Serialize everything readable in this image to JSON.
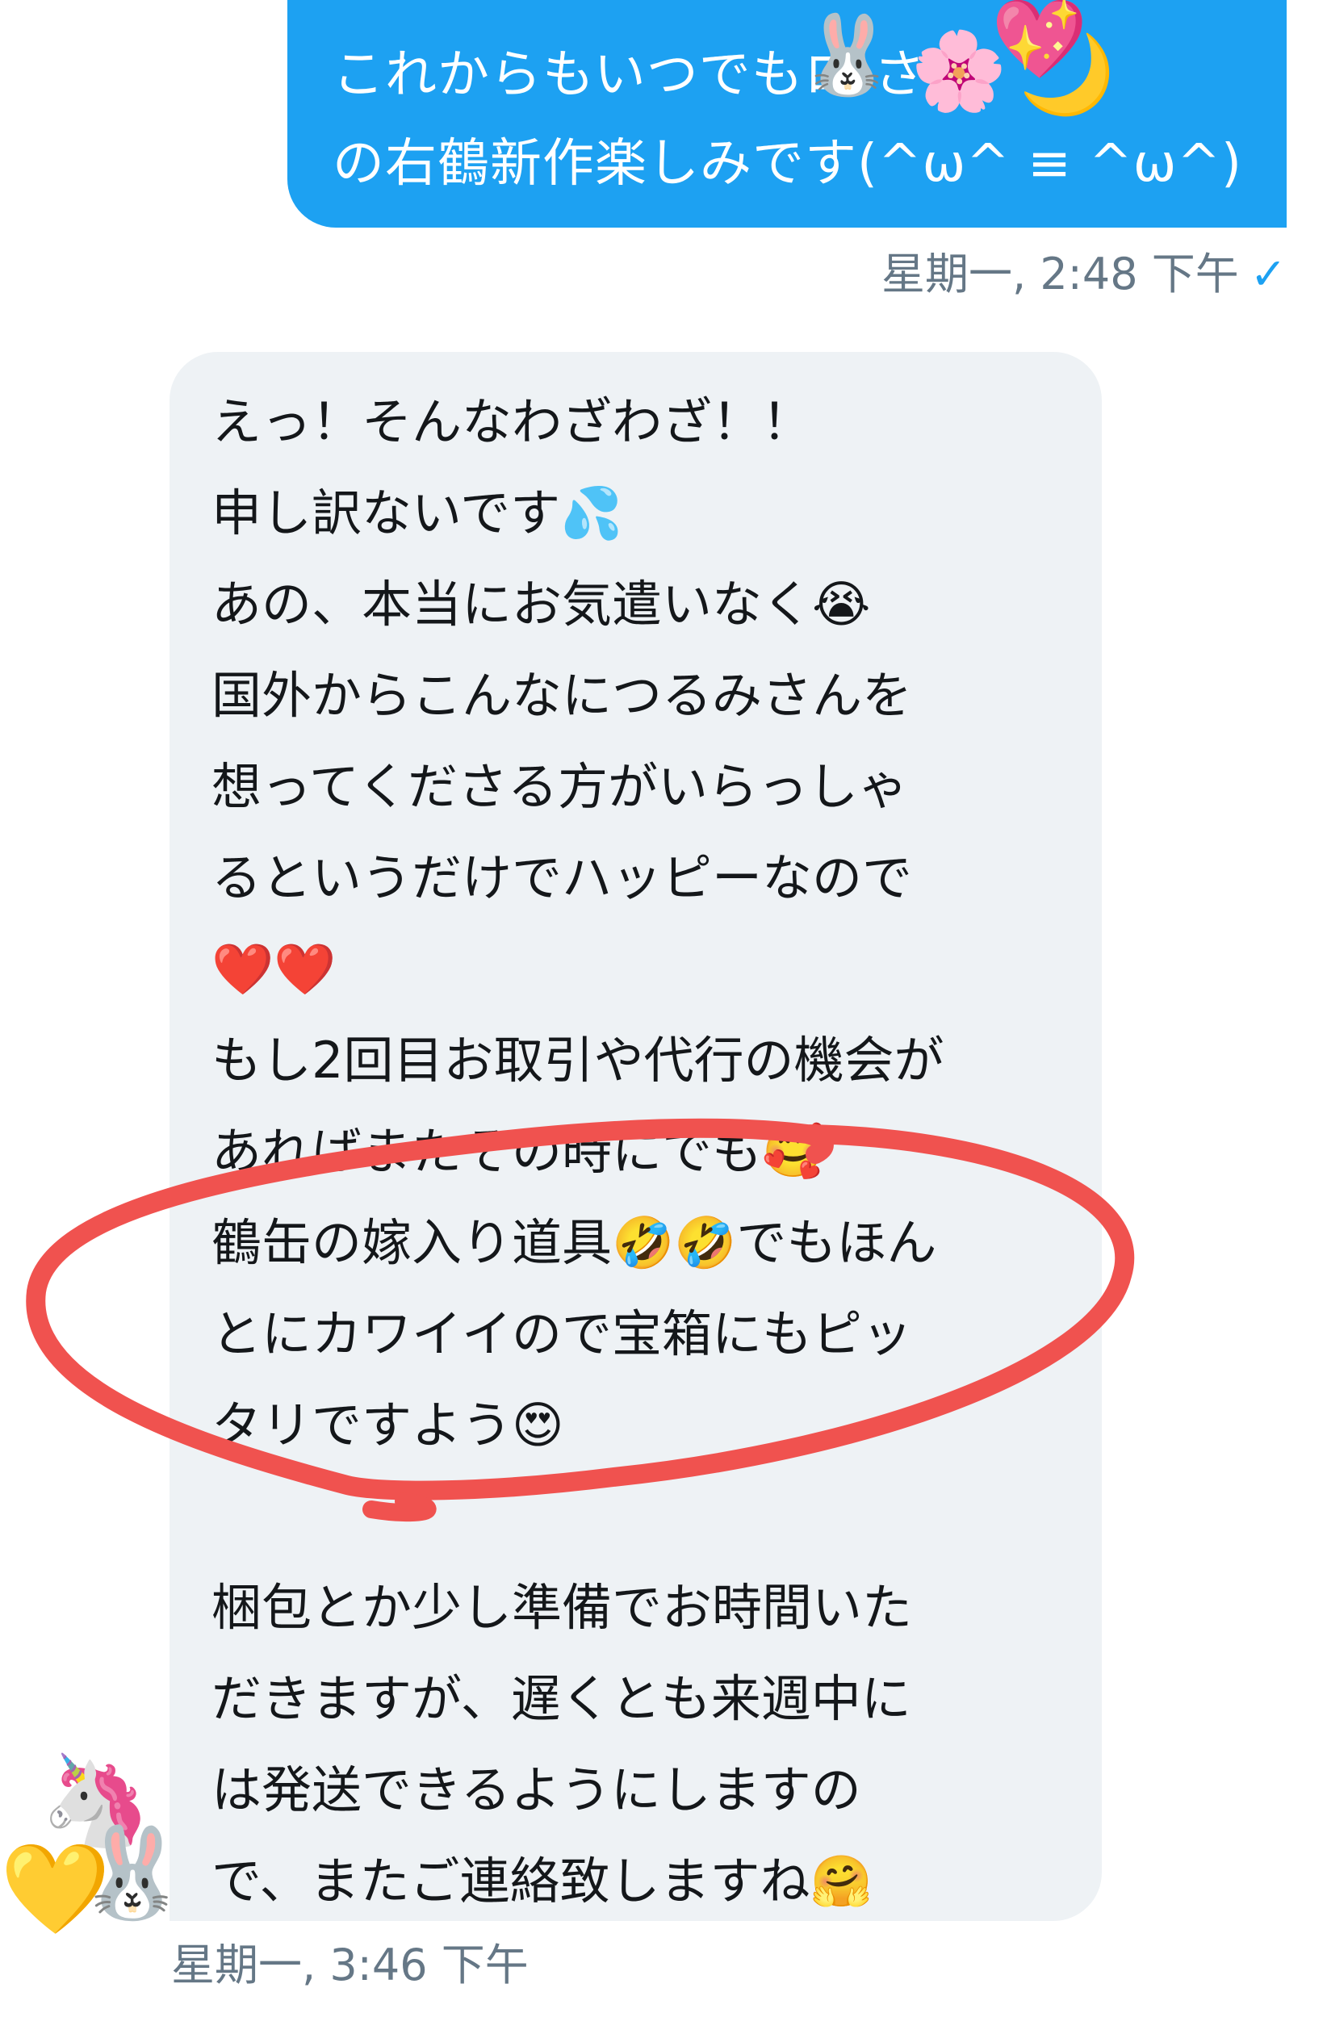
{
  "outgoing": {
    "lines": [
      "これからもいつでもロ    さん",
      "の右鶴新作楽しみです(^ω^ ≡ ^ω^)"
    ],
    "timestamp": "星期一, 2:48 下午",
    "read_mark": "✓",
    "stickers": [
      "🐰",
      "🌸",
      "💖",
      "🌙"
    ]
  },
  "incoming": {
    "lines": [
      "えっ！そんなわざわざ！！",
      "申し訳ないです💦",
      "あの、本当にお気遣いなく😭",
      "国外からこんなにつるみさんを",
      "想ってくださる方がいらっしゃ",
      "るというだけでハッピーなので",
      "❤️❤️",
      "もし2回目お取引や代行の機会が",
      "あればまたその時にでも🥰",
      "鶴缶の嫁入り道具🤣🤣でもほん",
      "とにカワイイので宝箱にもピッ",
      "タリですよう😍",
      "",
      "梱包とか少し準備でお時間いた",
      "だきますが、遅くとも来週中に",
      "は発送できるようにしますの",
      "で、またご連絡致しますね🤗"
    ],
    "timestamp": "星期一, 3:46 下午"
  },
  "avatar": {
    "emojis": [
      "🦄",
      "💛",
      "🐰"
    ]
  },
  "colors": {
    "outgoing_bubble": "#1da1f2",
    "incoming_bubble": "#eef2f5",
    "timestamp": "#657786",
    "annotation_circle": "#f0524f"
  }
}
